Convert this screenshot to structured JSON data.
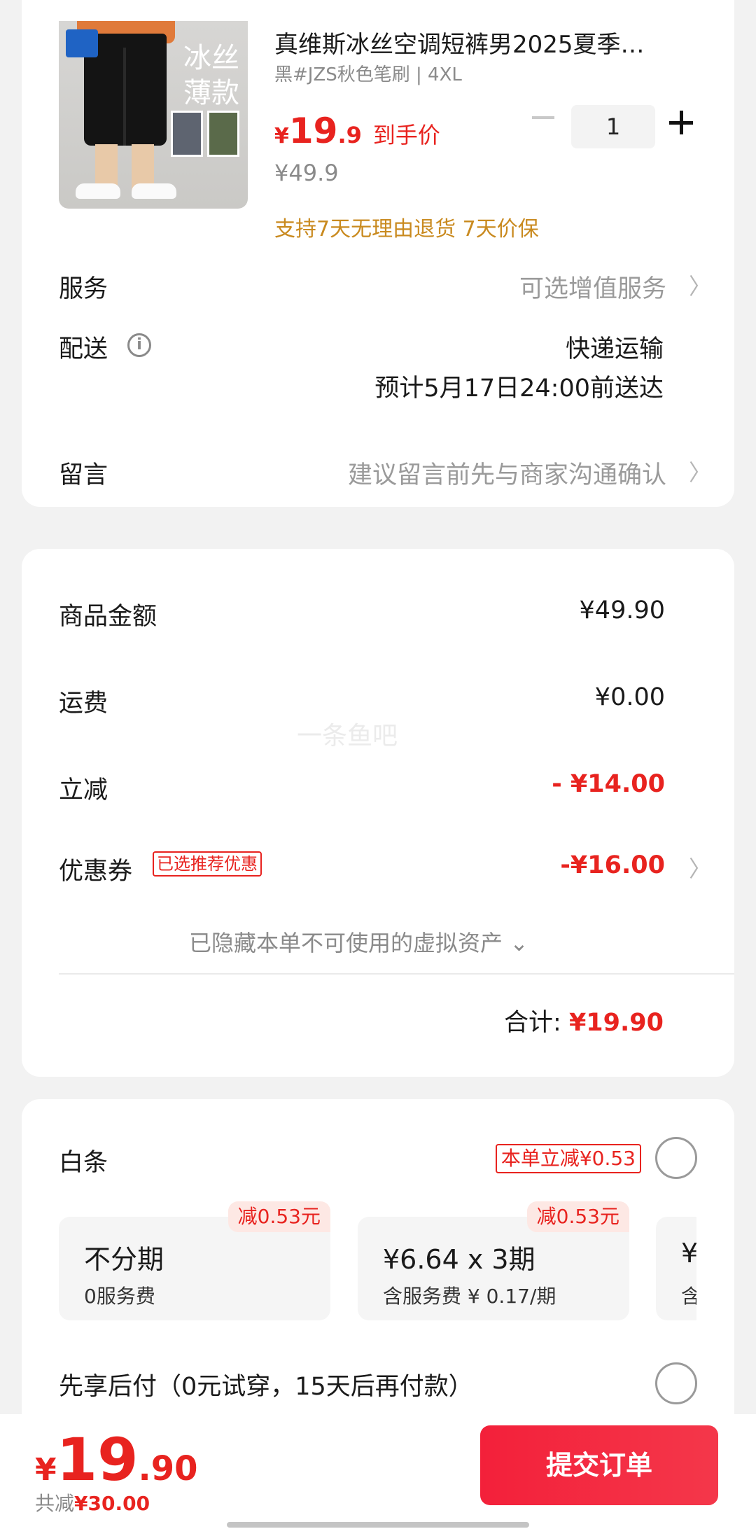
{
  "product": {
    "title": "真维斯冰丝空调短裤男2025夏季…",
    "spec": "黑#JZS秋色笔刷 | 4XL",
    "price_currency": "¥",
    "price_int": "19",
    "price_dec": ".9",
    "price_tag": "到手价",
    "original_price": "¥49.9",
    "quantity": "1",
    "guarantee": "支持7天无理由退货  7天价保",
    "image": {
      "brand": "JeansWest 真维斯",
      "promo_line1": "冰丝",
      "promo_line2": "薄款"
    }
  },
  "service": {
    "label": "服务",
    "value": "可选增值服务"
  },
  "delivery": {
    "label": "配送",
    "method": "快递运输",
    "eta": "预计5月17日24:00前送达"
  },
  "message": {
    "label": "留言",
    "placeholder": "建议留言前先与商家沟通确认"
  },
  "summary": {
    "goods_label": "商品金额",
    "goods_value": "¥49.90",
    "shipping_label": "运费",
    "shipping_value": "¥0.00",
    "discount_label": "立减",
    "discount_value": "- ¥14.00",
    "coupon_label": "优惠券",
    "coupon_tag": "已选推荐优惠",
    "coupon_value": "-¥16.00",
    "hidden_assets": "已隐藏本单不可使用的虚拟资产 ⌄",
    "total_label": "合计:",
    "total_value": "¥19.90"
  },
  "watermark": "一条鱼吧",
  "baitiao": {
    "label": "白条",
    "promo": "本单立减¥0.53",
    "plans": [
      {
        "badge": "减0.53元",
        "title": "不分期",
        "subtitle": "0服务费"
      },
      {
        "badge": "减0.53元",
        "title": "¥6.64 x 3期",
        "subtitle": "含服务费 ¥ 0.17/期"
      },
      {
        "badge": "",
        "title": "¥",
        "subtitle": "含"
      }
    ]
  },
  "pay_later": {
    "label": "先享后付（0元试穿，15天后再付款）"
  },
  "footer": {
    "currency": "¥",
    "total_int": "19",
    "total_dec": ".90",
    "saved_label": "共减",
    "saved_amount": "¥30.00",
    "submit_label": "提交订单"
  },
  "colors": {
    "accent_red": "#e8231f",
    "guarantee_orange": "#c98a1f",
    "button_red": "#f3203a"
  }
}
